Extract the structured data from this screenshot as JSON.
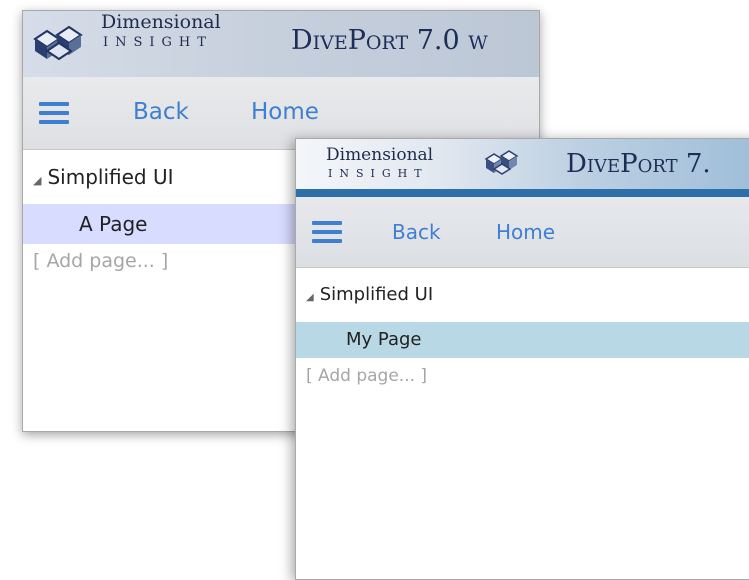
{
  "back_window": {
    "brand_top": "Dimensional",
    "brand_bottom": "INSIGHT",
    "product_title": "DivePort 7.0 w",
    "toolbar": {
      "back_label": "Back",
      "home_label": "Home",
      "menu_icon": "hamburger-menu-icon"
    },
    "tree": {
      "root_label": "Simplified UI",
      "items": [
        {
          "label": "A Page",
          "selected": true
        }
      ],
      "add_page_label": "[ Add page... ]"
    },
    "colors": {
      "selected_row": "#d8dcff",
      "link": "#3f7fd0"
    }
  },
  "front_window": {
    "brand_top": "Dimensional",
    "brand_bottom": "INSIGHT",
    "product_title": "DivePort 7.",
    "toolbar": {
      "back_label": "Back",
      "home_label": "Home",
      "menu_icon": "hamburger-menu-icon"
    },
    "tree": {
      "root_label": "Simplified UI",
      "items": [
        {
          "label": "My Page",
          "selected": true
        }
      ],
      "add_page_label": "[ Add page... ]"
    },
    "colors": {
      "selected_row": "#b8d8e6",
      "link": "#3f7fd0",
      "banner_stripe": "#2d6fa9"
    }
  }
}
